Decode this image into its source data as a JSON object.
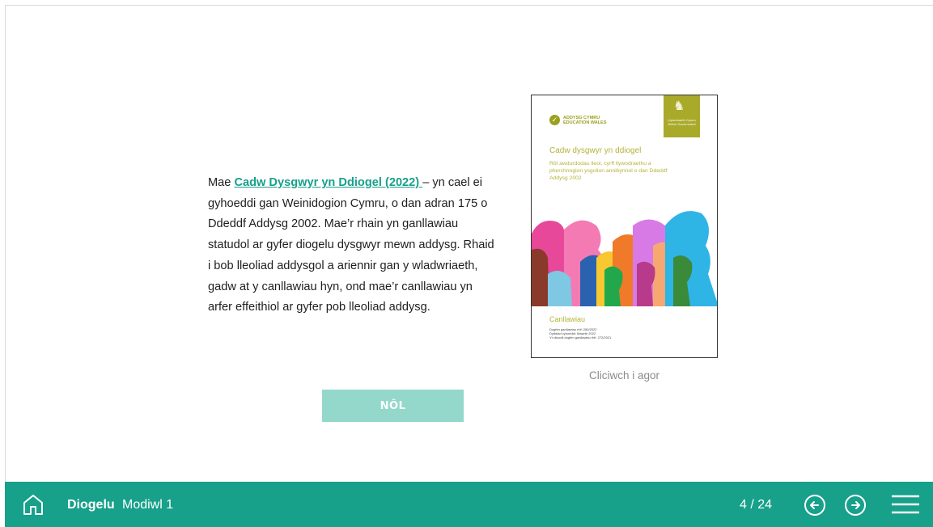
{
  "content": {
    "intro_prefix": "Mae ",
    "link_text": "Cadw Dysgwyr yn Ddiogel (2022) ",
    "body_rest": "– yn cael ei gyhoeddi gan Weinidogion Cymru, o dan adran 175 o Ddeddf Addysg 2002. Mae’r rhain yn ganllawiau statudol ar gyfer diogelu dysgwyr mewn addysg. Rhaid i bob lleoliad addysgol a ariennir gan y wladwriaeth, gadw at y canllawiau hyn, ond mae’r canllawiau yn arfer effeithiol ar gyfer pob lleoliad addysg.",
    "back_button": "NÔL"
  },
  "document": {
    "logo_line1": "ADDYSG CYMRU",
    "logo_line2": "EDUCATION WALES",
    "gov_line1": "Llywodraeth Cymru",
    "gov_line2": "Welsh Government",
    "title": "Cadw dysgwyr yn ddiogel",
    "subtitle": "Rôl awdurdodau lleol, cyrff llywodraethu a pherchnogion ysgolion annibynnol o dan Ddeddf Addysg 2002",
    "footer_title": "Canllawiau",
    "footer_line1": "Dogfen ganllawiau rhif: 280/2022",
    "footer_line2": "Dyddiad cyhoeddi: Mawrth 2022",
    "footer_line3": "Yn disodli dogfen ganllawiau rhif: 272/2021",
    "caption": "Cliciwch i agor"
  },
  "bottombar": {
    "course_title": "Diogelu",
    "module": "Modiwl 1",
    "page_counter": "4 / 24"
  },
  "colors": {
    "brand": "#17a08a",
    "button_disabled": "#93d8cb",
    "doc_accent": "#b5b43a"
  },
  "icons": [
    "home-icon",
    "arrow-left-circle-icon",
    "arrow-right-circle-icon",
    "hamburger-menu-icon"
  ]
}
